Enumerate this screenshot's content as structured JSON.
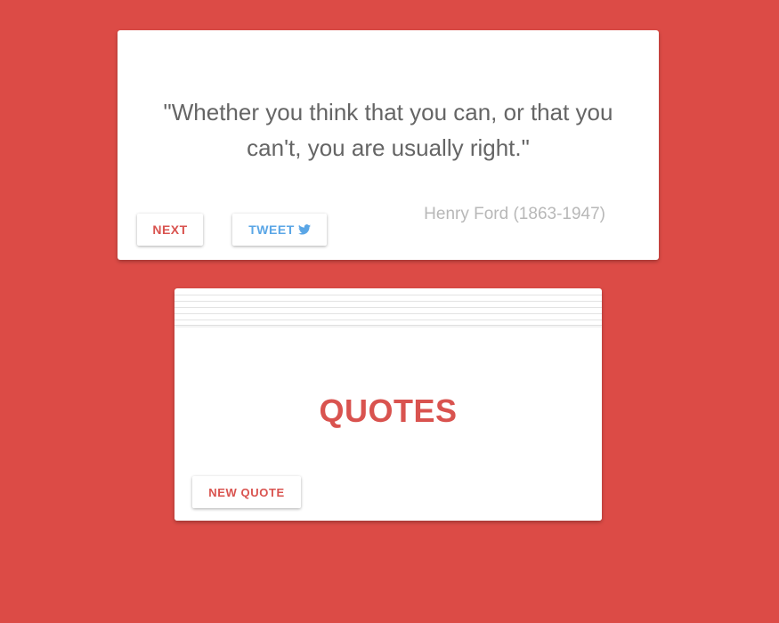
{
  "colors": {
    "background": "#dc4b46",
    "accent": "#d9534f",
    "tweet": "#5aa6e6",
    "quote_text": "#656565",
    "author_text": "#b8b8b8"
  },
  "quote_card": {
    "text": "\"Whether you think that you can, or that you can't, you are usually right.\"",
    "author": "Henry Ford (1863-1947)",
    "next_label": "NEXT",
    "tweet_label": "TWEET",
    "tweet_icon": "twitter-bird-icon"
  },
  "quotes_card": {
    "title": "QUOTES",
    "new_quote_label": "NEW QUOTE"
  }
}
